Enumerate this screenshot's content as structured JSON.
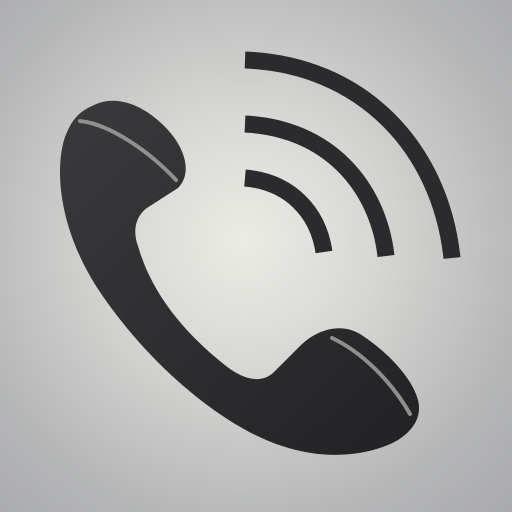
{
  "icon": {
    "semantic": "phone-call-icon",
    "handset_color": "#2b2b2d",
    "band_color": "#9a9a9a",
    "background_center": "#ecece6",
    "background_edge": "#a9aaac",
    "signal_wave_count": 3
  }
}
